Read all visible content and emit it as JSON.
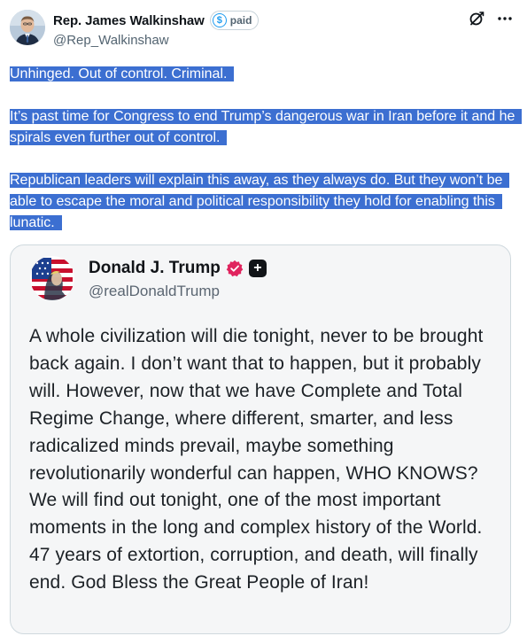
{
  "author": {
    "name": "Rep. James Walkinshaw",
    "badge_label": "paid",
    "badge_symbol": "$",
    "handle": "@Rep_Walkinshaw"
  },
  "actions": {
    "grok_icon": "grok-icon",
    "more_icon": "more-icon"
  },
  "tweet": {
    "paragraphs": [
      "Unhinged. Out of control. Criminal.",
      "It’s past time for Congress to end Trump’s dangerous war in Iran before it and he spirals even further out of control.",
      "Republican leaders will explain this away, as they always do. But they won’t be able to escape the moral and political responsibility they hold for enabling this lunatic."
    ],
    "selection_color": "#3c6fd1"
  },
  "embedded_post": {
    "name": "Donald J. Trump",
    "handle": "@realDonaldTrump",
    "verified_color": "#e0245e",
    "plus_symbol": "+",
    "body": "A whole civilization will die tonight, never to be brought back again. I don’t want that to happen, but it probably will. However, now that we have Complete and Total Regime Change, where different, smarter, and less radicalized minds prevail, maybe something revolutionarily wonderful can happen, WHO KNOWS? We will find out tonight, one of the most important moments in the long and complex history of the World. 47 years of extortion, corruption, and death, will finally end. God Bless the Great People of Iran!"
  }
}
